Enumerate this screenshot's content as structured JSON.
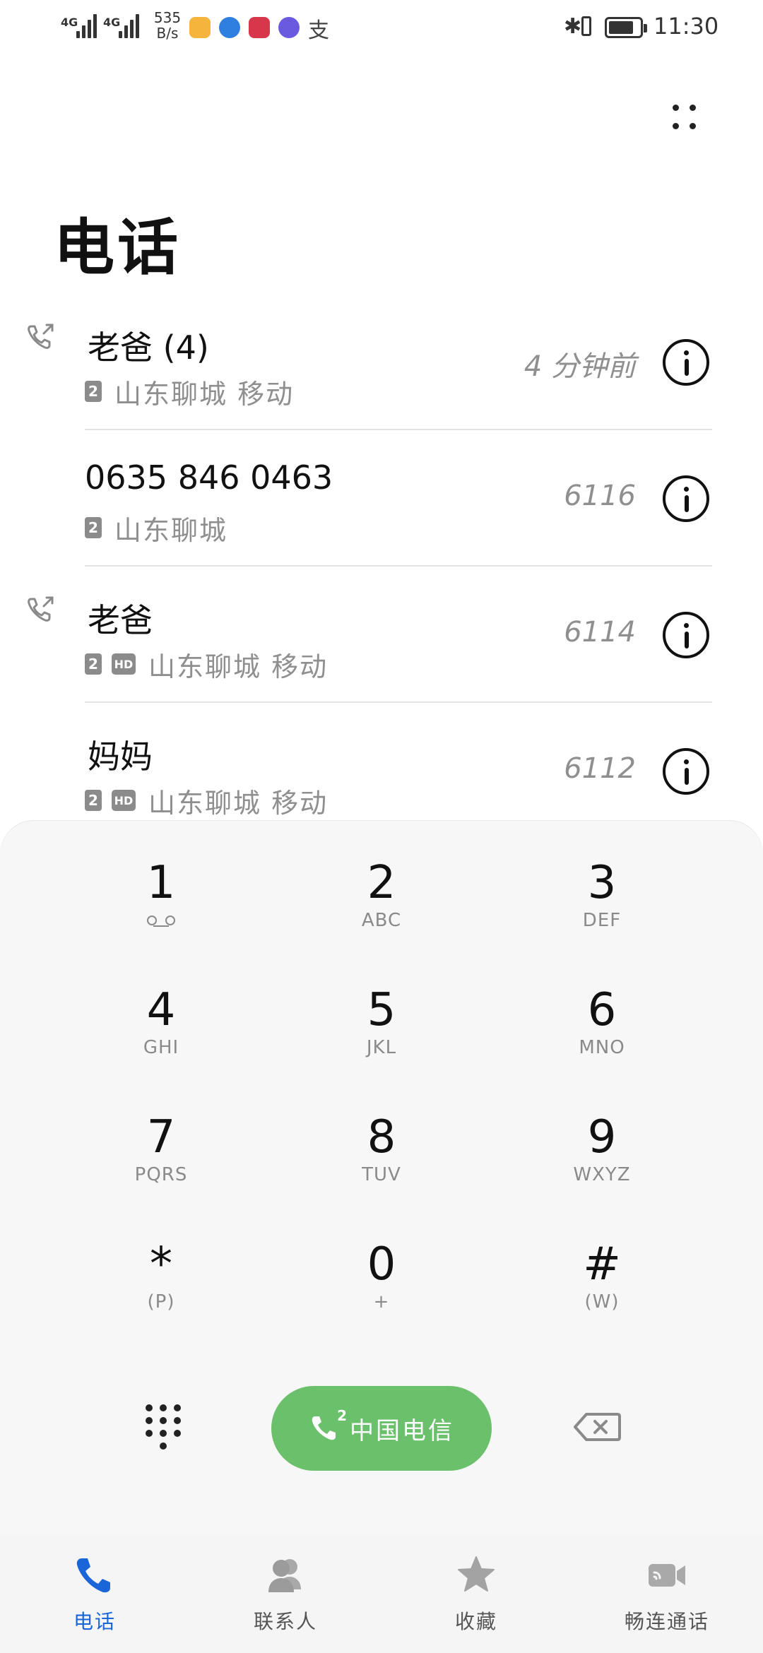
{
  "status_bar": {
    "signal_1": "4G",
    "signal_2": "4G",
    "net_speed_value": "535",
    "net_speed_unit": "B/s",
    "alipay_char": "支",
    "bluetooth_glyph": "✱",
    "time": "11:30"
  },
  "header": {
    "title": "电话"
  },
  "calls": [
    {
      "name": "老爸 (4)",
      "sim": "2",
      "hd": false,
      "location": "山东聊城 移动",
      "time": "4 分钟前",
      "outgoing": true
    },
    {
      "name": "0635 846 0463",
      "sim": "2",
      "hd": false,
      "location": "山东聊城",
      "time": "6116",
      "outgoing": false
    },
    {
      "name": "老爸",
      "sim": "2",
      "hd": true,
      "hd_label": "HD",
      "location": "山东聊城 移动",
      "time": "6114",
      "outgoing": true
    },
    {
      "name": "妈妈",
      "sim": "2",
      "hd": true,
      "hd_label": "HD",
      "location": "山东聊城 移动",
      "time": "6112",
      "outgoing": false
    }
  ],
  "dialpad": {
    "keys": [
      {
        "digit": "1",
        "letters": ""
      },
      {
        "digit": "2",
        "letters": "ABC"
      },
      {
        "digit": "3",
        "letters": "DEF"
      },
      {
        "digit": "4",
        "letters": "GHI"
      },
      {
        "digit": "5",
        "letters": "JKL"
      },
      {
        "digit": "6",
        "letters": "MNO"
      },
      {
        "digit": "7",
        "letters": "PQRS"
      },
      {
        "digit": "8",
        "letters": "TUV"
      },
      {
        "digit": "9",
        "letters": "WXYZ"
      },
      {
        "digit": "*",
        "letters": "(P)"
      },
      {
        "digit": "0",
        "letters": "+"
      },
      {
        "digit": "#",
        "letters": "(W)"
      }
    ],
    "call_button_sim": "2",
    "call_button_label": "中国电信"
  },
  "bottom_nav": {
    "items": [
      {
        "label": "电话",
        "active": true
      },
      {
        "label": "联系人",
        "active": false
      },
      {
        "label": "收藏",
        "active": false
      },
      {
        "label": "畅连通话",
        "active": false
      }
    ]
  },
  "colors": {
    "accent": "#1a66d9",
    "call_green": "#6bc06b",
    "secondary_text": "#8f8f8f"
  }
}
